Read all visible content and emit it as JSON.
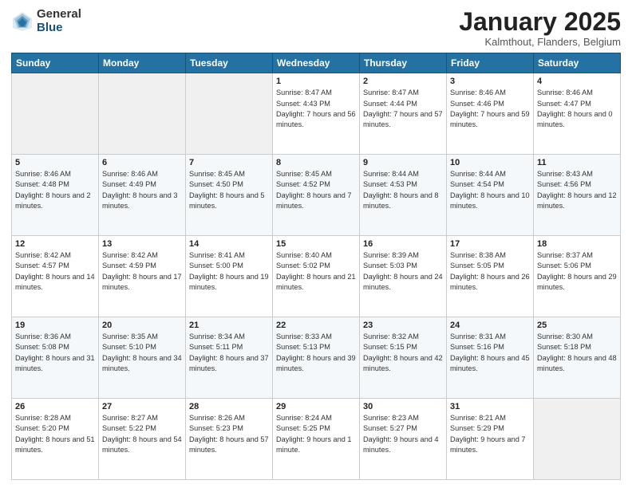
{
  "logo": {
    "general": "General",
    "blue": "Blue"
  },
  "title": "January 2025",
  "location": "Kalmthout, Flanders, Belgium",
  "days_header": [
    "Sunday",
    "Monday",
    "Tuesday",
    "Wednesday",
    "Thursday",
    "Friday",
    "Saturday"
  ],
  "weeks": [
    [
      {
        "num": "",
        "sunrise": "",
        "sunset": "",
        "daylight": ""
      },
      {
        "num": "",
        "sunrise": "",
        "sunset": "",
        "daylight": ""
      },
      {
        "num": "",
        "sunrise": "",
        "sunset": "",
        "daylight": ""
      },
      {
        "num": "1",
        "sunrise": "Sunrise: 8:47 AM",
        "sunset": "Sunset: 4:43 PM",
        "daylight": "Daylight: 7 hours and 56 minutes."
      },
      {
        "num": "2",
        "sunrise": "Sunrise: 8:47 AM",
        "sunset": "Sunset: 4:44 PM",
        "daylight": "Daylight: 7 hours and 57 minutes."
      },
      {
        "num": "3",
        "sunrise": "Sunrise: 8:46 AM",
        "sunset": "Sunset: 4:46 PM",
        "daylight": "Daylight: 7 hours and 59 minutes."
      },
      {
        "num": "4",
        "sunrise": "Sunrise: 8:46 AM",
        "sunset": "Sunset: 4:47 PM",
        "daylight": "Daylight: 8 hours and 0 minutes."
      }
    ],
    [
      {
        "num": "5",
        "sunrise": "Sunrise: 8:46 AM",
        "sunset": "Sunset: 4:48 PM",
        "daylight": "Daylight: 8 hours and 2 minutes."
      },
      {
        "num": "6",
        "sunrise": "Sunrise: 8:46 AM",
        "sunset": "Sunset: 4:49 PM",
        "daylight": "Daylight: 8 hours and 3 minutes."
      },
      {
        "num": "7",
        "sunrise": "Sunrise: 8:45 AM",
        "sunset": "Sunset: 4:50 PM",
        "daylight": "Daylight: 8 hours and 5 minutes."
      },
      {
        "num": "8",
        "sunrise": "Sunrise: 8:45 AM",
        "sunset": "Sunset: 4:52 PM",
        "daylight": "Daylight: 8 hours and 7 minutes."
      },
      {
        "num": "9",
        "sunrise": "Sunrise: 8:44 AM",
        "sunset": "Sunset: 4:53 PM",
        "daylight": "Daylight: 8 hours and 8 minutes."
      },
      {
        "num": "10",
        "sunrise": "Sunrise: 8:44 AM",
        "sunset": "Sunset: 4:54 PM",
        "daylight": "Daylight: 8 hours and 10 minutes."
      },
      {
        "num": "11",
        "sunrise": "Sunrise: 8:43 AM",
        "sunset": "Sunset: 4:56 PM",
        "daylight": "Daylight: 8 hours and 12 minutes."
      }
    ],
    [
      {
        "num": "12",
        "sunrise": "Sunrise: 8:42 AM",
        "sunset": "Sunset: 4:57 PM",
        "daylight": "Daylight: 8 hours and 14 minutes."
      },
      {
        "num": "13",
        "sunrise": "Sunrise: 8:42 AM",
        "sunset": "Sunset: 4:59 PM",
        "daylight": "Daylight: 8 hours and 17 minutes."
      },
      {
        "num": "14",
        "sunrise": "Sunrise: 8:41 AM",
        "sunset": "Sunset: 5:00 PM",
        "daylight": "Daylight: 8 hours and 19 minutes."
      },
      {
        "num": "15",
        "sunrise": "Sunrise: 8:40 AM",
        "sunset": "Sunset: 5:02 PM",
        "daylight": "Daylight: 8 hours and 21 minutes."
      },
      {
        "num": "16",
        "sunrise": "Sunrise: 8:39 AM",
        "sunset": "Sunset: 5:03 PM",
        "daylight": "Daylight: 8 hours and 24 minutes."
      },
      {
        "num": "17",
        "sunrise": "Sunrise: 8:38 AM",
        "sunset": "Sunset: 5:05 PM",
        "daylight": "Daylight: 8 hours and 26 minutes."
      },
      {
        "num": "18",
        "sunrise": "Sunrise: 8:37 AM",
        "sunset": "Sunset: 5:06 PM",
        "daylight": "Daylight: 8 hours and 29 minutes."
      }
    ],
    [
      {
        "num": "19",
        "sunrise": "Sunrise: 8:36 AM",
        "sunset": "Sunset: 5:08 PM",
        "daylight": "Daylight: 8 hours and 31 minutes."
      },
      {
        "num": "20",
        "sunrise": "Sunrise: 8:35 AM",
        "sunset": "Sunset: 5:10 PM",
        "daylight": "Daylight: 8 hours and 34 minutes."
      },
      {
        "num": "21",
        "sunrise": "Sunrise: 8:34 AM",
        "sunset": "Sunset: 5:11 PM",
        "daylight": "Daylight: 8 hours and 37 minutes."
      },
      {
        "num": "22",
        "sunrise": "Sunrise: 8:33 AM",
        "sunset": "Sunset: 5:13 PM",
        "daylight": "Daylight: 8 hours and 39 minutes."
      },
      {
        "num": "23",
        "sunrise": "Sunrise: 8:32 AM",
        "sunset": "Sunset: 5:15 PM",
        "daylight": "Daylight: 8 hours and 42 minutes."
      },
      {
        "num": "24",
        "sunrise": "Sunrise: 8:31 AM",
        "sunset": "Sunset: 5:16 PM",
        "daylight": "Daylight: 8 hours and 45 minutes."
      },
      {
        "num": "25",
        "sunrise": "Sunrise: 8:30 AM",
        "sunset": "Sunset: 5:18 PM",
        "daylight": "Daylight: 8 hours and 48 minutes."
      }
    ],
    [
      {
        "num": "26",
        "sunrise": "Sunrise: 8:28 AM",
        "sunset": "Sunset: 5:20 PM",
        "daylight": "Daylight: 8 hours and 51 minutes."
      },
      {
        "num": "27",
        "sunrise": "Sunrise: 8:27 AM",
        "sunset": "Sunset: 5:22 PM",
        "daylight": "Daylight: 8 hours and 54 minutes."
      },
      {
        "num": "28",
        "sunrise": "Sunrise: 8:26 AM",
        "sunset": "Sunset: 5:23 PM",
        "daylight": "Daylight: 8 hours and 57 minutes."
      },
      {
        "num": "29",
        "sunrise": "Sunrise: 8:24 AM",
        "sunset": "Sunset: 5:25 PM",
        "daylight": "Daylight: 9 hours and 1 minute."
      },
      {
        "num": "30",
        "sunrise": "Sunrise: 8:23 AM",
        "sunset": "Sunset: 5:27 PM",
        "daylight": "Daylight: 9 hours and 4 minutes."
      },
      {
        "num": "31",
        "sunrise": "Sunrise: 8:21 AM",
        "sunset": "Sunset: 5:29 PM",
        "daylight": "Daylight: 9 hours and 7 minutes."
      },
      {
        "num": "",
        "sunrise": "",
        "sunset": "",
        "daylight": ""
      }
    ]
  ]
}
